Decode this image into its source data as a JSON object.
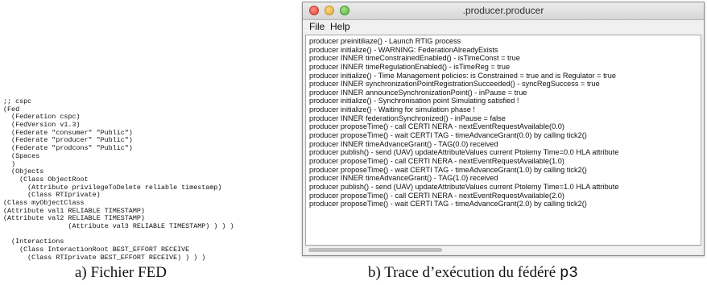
{
  "fed_file": {
    "lines": [
      ";; cspc",
      "(Fed",
      "  (Federation cspc)",
      "  (FedVersion v1.3)",
      "  (Federate \"consumer\" \"Public\")",
      "  (Federate \"producer\" \"Public\")",
      "  (Federate \"prodcons\" \"Public\")",
      "  (Spaces",
      "  )",
      "  (Objects",
      "    (Class ObjectRoot",
      "      (Attribute privilegeToDelete reliable timestamp)",
      "      (Class RTIprivate)",
      "(Class myObjectClass",
      "(Attribute val1 RELIABLE TIMESTAMP)",
      "(Attribute val2 RELIABLE TIMESTAMP)",
      "                (Attribute val3 RELIABLE TIMESTAMP) ) ) )",
      "",
      "  (Interactions",
      "    (Class InteractionRoot BEST_EFFORT RECEIVE",
      "      (Class RTIprivate BEST_EFFORT RECEIVE) ) ) )"
    ]
  },
  "captions": {
    "a": "a) Fichier FED",
    "b_text": "b) Trace d’exécution du fédéré ",
    "b_mono": "p3"
  },
  "window": {
    "title": ".producer.producer",
    "menu": {
      "file": "File",
      "help": "Help"
    },
    "trace_lines": [
      "producer preinitiliaze() - Launch RTIG process",
      "producer initialize() - WARNING: FederationAlreadyExists",
      "producer INNER timeConstrainedEnabled() - isTimeConst = true",
      "producer INNER timeRegulationEnabled() - isTimeReg = true",
      "producer initialize() - Time Management policies: is Constrained = true and is Regulator = true",
      "producer INNER synchronizationPointRegistrationSucceeded() - syncRegSuccess = true",
      "producer INNER announceSynchronizationPoint() - inPause = true",
      "producer initialize() - Synchronisation point Simulating satisfied !",
      "producer initialize() - Waiting for simulation phase !",
      "producer INNER federationSynchronized() - inPause = false",
      "producer proposeTime() - call CERTI NERA - nextEventRequestAvailable(0.0)",
      "producer proposeTime() - wait CERTI TAG - timeAdvanceGrant(0.0) by calling tick2()",
      "producer INNER timeAdvanceGrant() - TAG(0.0) received",
      "producer publish() - send (UAV) updateAttributeValues  current Ptolemy Time=0.0 HLA attribute",
      "producer proposeTime() - call CERTI NERA - nextEventRequestAvailable(1.0)",
      "producer proposeTime() - wait CERTI TAG - timeAdvanceGrant(1.0) by calling tick2()",
      "producer INNER timeAdvanceGrant() - TAG(1.0) received",
      "producer publish() - send (UAV) updateAttributeValues  current Ptolemy Time=1.0 HLA attribute",
      "producer proposeTime() - call CERTI NERA - nextEventRequestAvailable(2.0)",
      "producer proposeTime() - wait CERTI TAG - timeAdvanceGrant(2.0) by calling tick2()"
    ]
  }
}
